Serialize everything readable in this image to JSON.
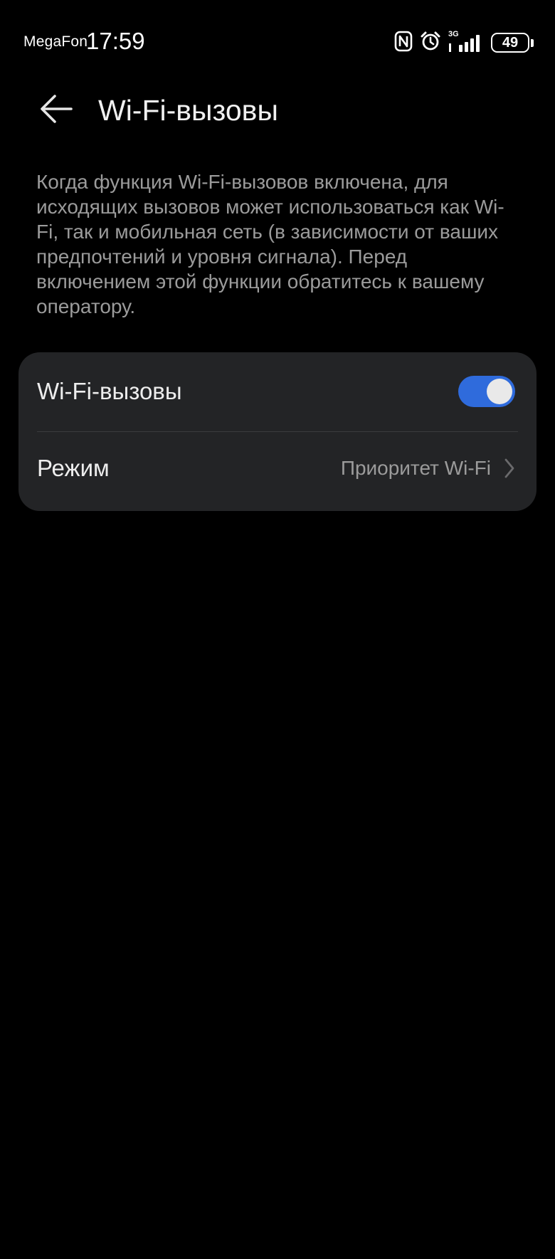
{
  "status_bar": {
    "carrier": "MegaFon",
    "time": "17:59",
    "network_type": "3G",
    "battery_level": "49",
    "icons": [
      "nfc-icon",
      "alarm-icon",
      "signal-icon",
      "battery-icon"
    ]
  },
  "header": {
    "title": "Wi-Fi-вызовы",
    "back_icon": "arrow-left-icon"
  },
  "description": "Когда функция Wi-Fi-вызовов включена, для исходящих вызовов может использоваться как Wi-Fi, так и мобильная сеть (в зависимости от ваших предпочтений и уровня сигнала). Перед включением этой функции обратитесь к вашему оператору.",
  "settings": {
    "wifi_calling": {
      "label": "Wi-Fi-вызовы",
      "enabled": true
    },
    "mode": {
      "label": "Режим",
      "value": "Приоритет Wi-Fi"
    }
  },
  "colors": {
    "background": "#000000",
    "card": "#232426",
    "accent": "#2f6bdc",
    "secondary_text": "#9b9b9b"
  }
}
